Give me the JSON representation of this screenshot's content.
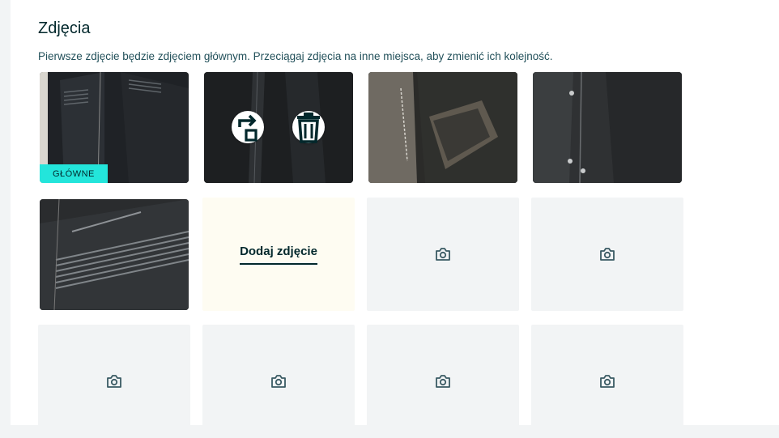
{
  "section": {
    "title": "Zdjęcia",
    "hint": "Pierwsze zdjęcie będzie zdjęciem głównym. Przeciągaj zdjęcia na inne miejsca, aby zmienić ich kolejność."
  },
  "photos": [
    {
      "badge": "GŁÓWNE"
    },
    {
      "actions": [
        "rotate-icon",
        "trash-icon"
      ]
    },
    {},
    {},
    {}
  ],
  "add_tile": {
    "label": "Dodaj zdjęcie"
  },
  "placeholder_icon": "camera-icon",
  "colors": {
    "badge_bg": "#23e5db",
    "text_dark": "#02282c",
    "placeholder_bg": "#f2f4f5",
    "add_tile_bg": "#fefcf2"
  }
}
